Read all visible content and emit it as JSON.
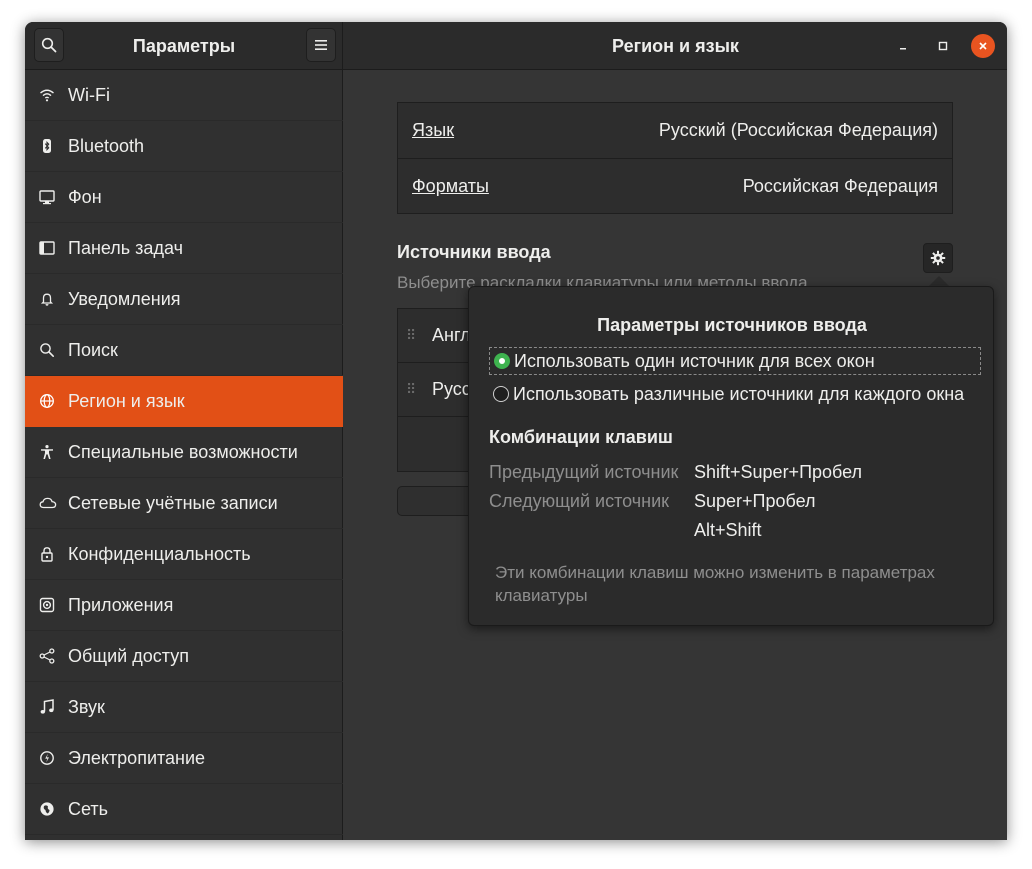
{
  "header": {
    "sidebar_title": "Параметры",
    "panel_title": "Регион и язык"
  },
  "sidebar": {
    "items": [
      {
        "label": "Wi-Fi",
        "icon": "wifi-icon"
      },
      {
        "label": "Bluetooth",
        "icon": "bluetooth-icon"
      },
      {
        "label": "Фон",
        "icon": "background-icon"
      },
      {
        "label": "Панель задач",
        "icon": "dock-icon"
      },
      {
        "label": "Уведомления",
        "icon": "bell-icon"
      },
      {
        "label": "Поиск",
        "icon": "search-icon"
      },
      {
        "label": "Регион и язык",
        "icon": "globe-icon",
        "active": true
      },
      {
        "label": "Специальные возможности",
        "icon": "accessibility-icon"
      },
      {
        "label": "Сетевые учётные записи",
        "icon": "cloud-icon"
      },
      {
        "label": "Конфиденциальность",
        "icon": "lock-icon"
      },
      {
        "label": "Приложения",
        "icon": "apps-icon"
      },
      {
        "label": "Общий доступ",
        "icon": "share-icon"
      },
      {
        "label": "Звук",
        "icon": "music-note-icon"
      },
      {
        "label": "Электропитание",
        "icon": "power-icon"
      },
      {
        "label": "Сеть",
        "icon": "network-icon"
      }
    ]
  },
  "region": {
    "language_label": "Язык",
    "language_value": "Русский (Российская Федерация)",
    "formats_label": "Форматы",
    "formats_value": "Российская Федерация"
  },
  "input_sources": {
    "title": "Источники ввода",
    "subtitle": "Выберите раскладки клавиатуры или методы ввода.",
    "sources": [
      "Англ",
      "Русс"
    ]
  },
  "popover": {
    "title": "Параметры источников ввода",
    "option_same": "Использовать один источник для всех окон",
    "option_different": "Использовать различные источники для каждого окна",
    "selected": "same",
    "shortcuts_title": "Комбинации клавиш",
    "prev_label": "Предыдущий источник",
    "prev_value": "Shift+Super+Пробел",
    "next_label": "Следующий источник",
    "next_value": "Super+Пробел",
    "next_value_alt": "Alt+Shift",
    "note": "Эти комбинации клавиш можно изменить в параметрах клавиатуры"
  },
  "colors": {
    "accent": "#e25016",
    "close_button": "#e95420",
    "radio_on": "#3eb34f"
  }
}
